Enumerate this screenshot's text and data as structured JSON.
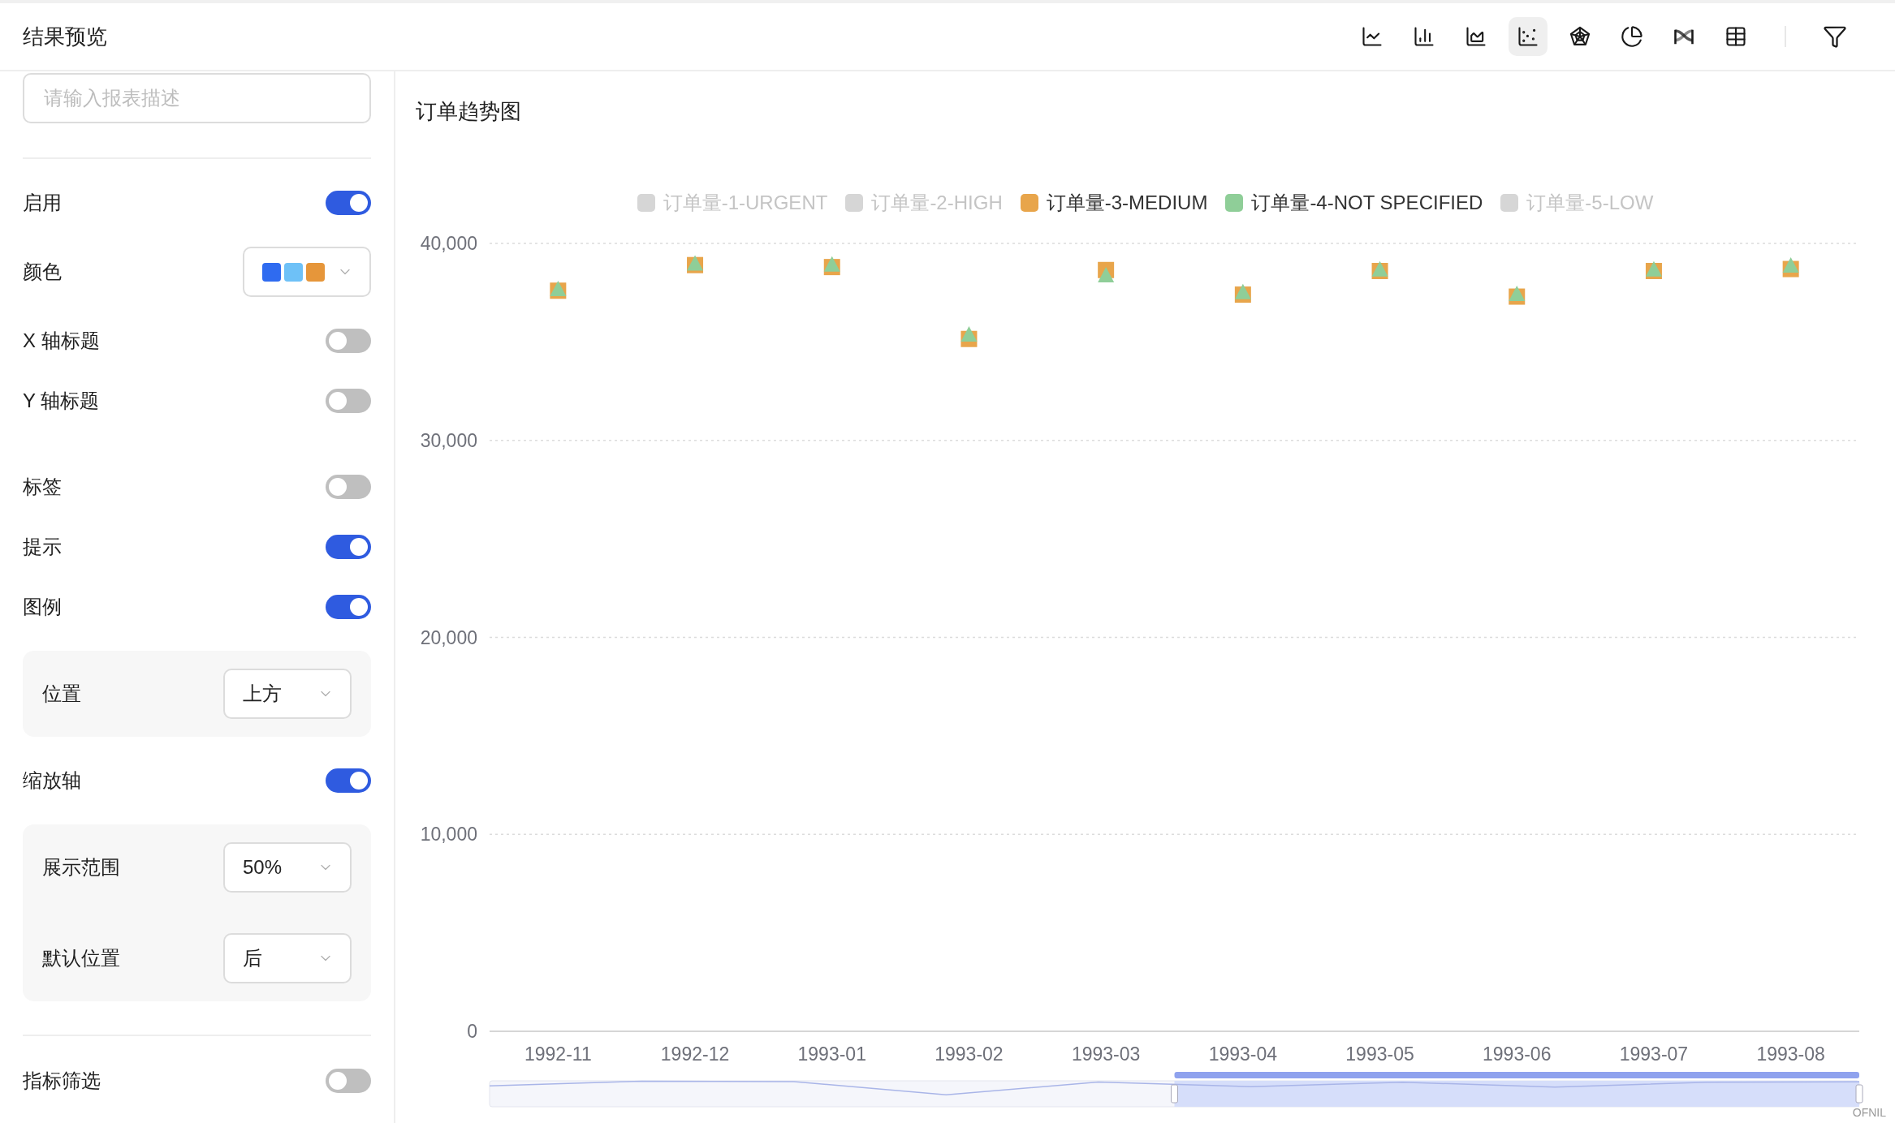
{
  "header": {
    "title": "结果预览",
    "chart_types": [
      {
        "kind": "line",
        "selected": false
      },
      {
        "kind": "bar",
        "selected": false
      },
      {
        "kind": "area",
        "selected": false
      },
      {
        "kind": "scatter",
        "selected": true
      },
      {
        "kind": "radar",
        "selected": false
      },
      {
        "kind": "pie",
        "selected": false
      },
      {
        "kind": "sankey",
        "selected": false
      },
      {
        "kind": "table",
        "selected": false
      }
    ]
  },
  "description_field": {
    "placeholder": "请输入报表描述"
  },
  "setting_groups": [
    {
      "items": [
        {
          "kind": "toggle",
          "label": "启用",
          "on": true
        },
        {
          "kind": "colors",
          "label": "颜色",
          "swatches": [
            {
              "color": "#2f6bf0"
            },
            {
              "color": "#6ec1f7"
            },
            {
              "color": "#e6963a"
            }
          ]
        },
        {
          "kind": "toggle",
          "label": "X 轴标题",
          "on": false
        },
        {
          "kind": "toggle",
          "label": "Y 轴标题",
          "on": false
        }
      ]
    },
    {
      "items": [
        {
          "kind": "toggle",
          "label": "标签",
          "on": false
        },
        {
          "kind": "toggle",
          "label": "提示",
          "on": true
        },
        {
          "kind": "toggle",
          "label": "图例",
          "on": true,
          "options": [
            {
              "label": "位置",
              "value": "上方"
            }
          ]
        },
        {
          "kind": "toggle",
          "label": "缩放轴",
          "on": true,
          "options": [
            {
              "label": "展示范围",
              "value": "50%"
            },
            {
              "label": "默认位置",
              "value": "后"
            }
          ]
        }
      ]
    }
  ],
  "filter_setting": {
    "label": "指标筛选",
    "on": false
  },
  "chart_panel": {
    "title": "订单趋势图",
    "legend": [
      {
        "kind": "hidden",
        "label": "订单量-1-URGENT",
        "selected": false
      },
      {
        "kind": "hidden",
        "label": "订单量-2-HIGH",
        "selected": false
      },
      {
        "kind": "series",
        "selected": true
      },
      {
        "kind": "series",
        "selected": true
      },
      {
        "kind": "hidden",
        "label": "订单量-5-LOW",
        "selected": false
      }
    ],
    "chart_data": {
      "type": "scatter",
      "grid": true,
      "legend": "top",
      "categories": [
        "1992-11",
        "1992-12",
        "1993-01",
        "1993-02",
        "1993-03",
        "1993-04",
        "1993-05",
        "1993-06",
        "1993-07",
        "1993-08"
      ],
      "ylim": [
        0,
        40000
      ],
      "yticks": [
        {
          "value": 0,
          "label": "0"
        },
        {
          "value": 10000,
          "label": "10,000"
        },
        {
          "value": 20000,
          "label": "20,000"
        },
        {
          "value": 30000,
          "label": "30,000"
        },
        {
          "value": 40000,
          "label": "40,000"
        }
      ],
      "series": [
        {
          "name": "订单量-3-MEDIUM",
          "color": "#e8a54b",
          "values": [
            37600,
            38900,
            38800,
            35150,
            38650,
            37400,
            38600,
            37300,
            38600,
            38700
          ]
        },
        {
          "name": "订单量-4-NOT SPECIFIED",
          "color": "#8fce98",
          "values": [
            37650,
            38950,
            38900,
            35350,
            38350,
            37500,
            38650,
            37400,
            38650,
            38850
          ]
        }
      ]
    },
    "zoom_range": {
      "level": 0.5
    },
    "corner_text": "OFNIL"
  }
}
